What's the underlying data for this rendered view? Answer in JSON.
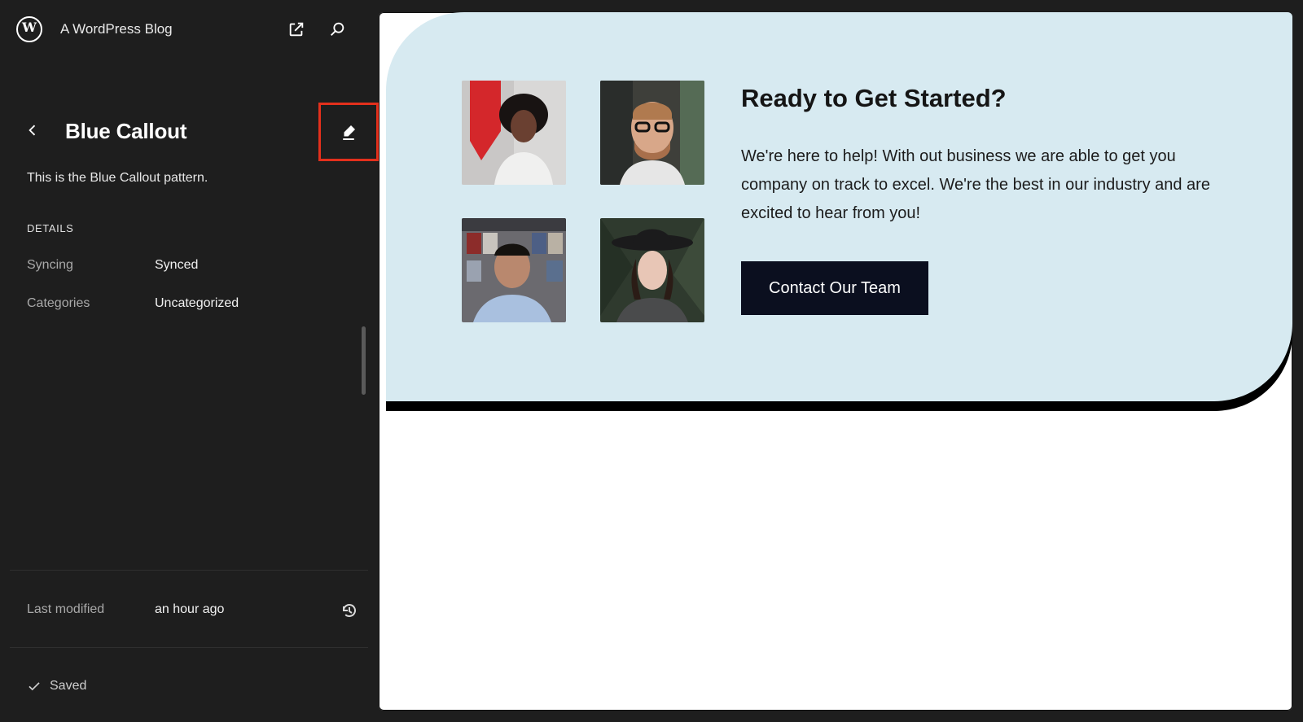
{
  "topbar": {
    "site_title": "A WordPress Blog",
    "logo_letter": "W"
  },
  "sidebar": {
    "title": "Blue Callout",
    "description": "This is the Blue Callout pattern.",
    "details_heading": "DETAILS",
    "details": {
      "syncing_label": "Syncing",
      "syncing_value": "Synced",
      "categories_label": "Categories",
      "categories_value": "Uncategorized"
    },
    "last_modified_label": "Last modified",
    "last_modified_value": "an hour ago",
    "status": "Saved"
  },
  "preview": {
    "title": "Ready to Get Started?",
    "body": "We're here to help! With out business we are able to get you company on track to excel. We're the best in our industry and are excited to hear from you!",
    "button": "Contact Our Team"
  },
  "colors": {
    "accent_red": "#e3301c",
    "callout_bg": "#d7eaf1",
    "sidebar_bg": "#1e1e1e",
    "cta_button_bg": "#0b0f1f"
  },
  "icons": {
    "logo": "wordpress-logo-icon",
    "external": "external-link-icon",
    "search": "search-icon",
    "back": "chevron-left-icon",
    "edit": "pencil-icon",
    "history": "history-icon",
    "saved": "check-icon"
  }
}
